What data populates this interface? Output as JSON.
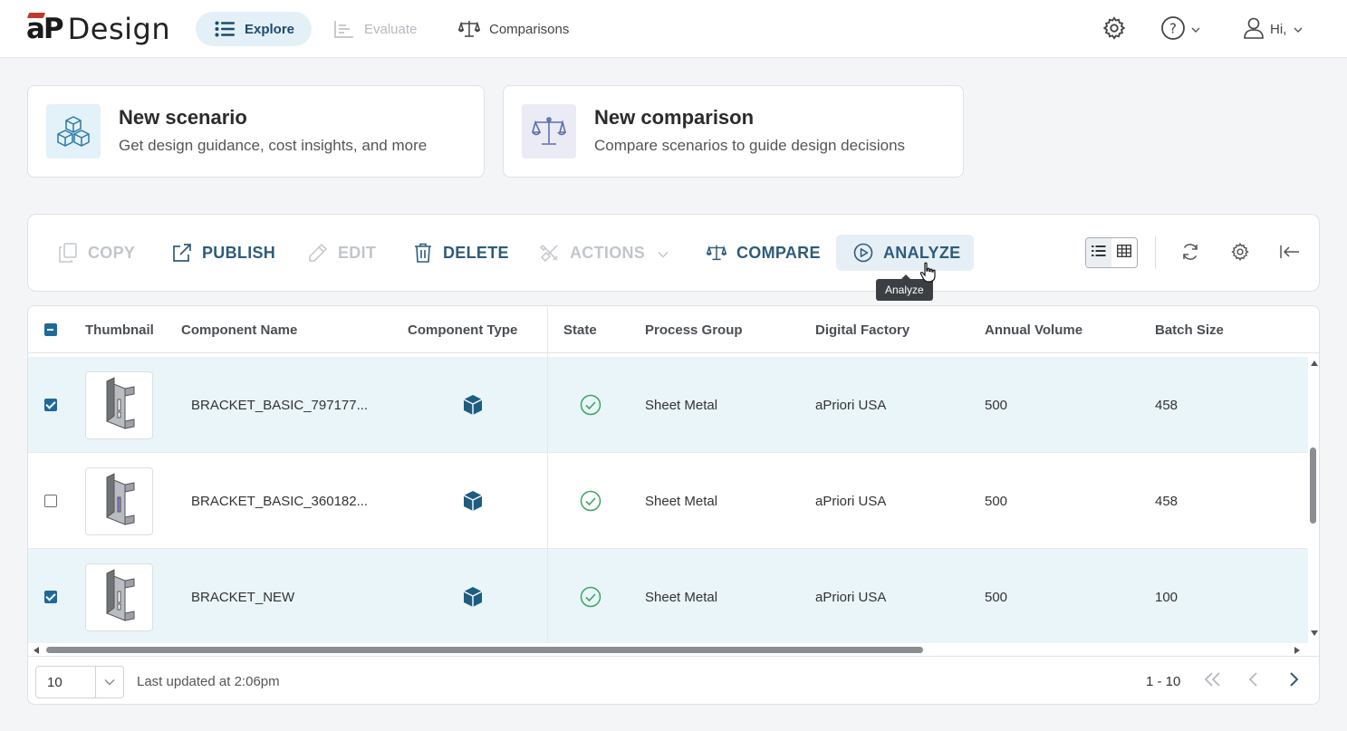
{
  "header": {
    "logo_mark": "aP",
    "logo_text": "Design",
    "nav": [
      {
        "label": "Explore",
        "icon": "list-icon",
        "state": "active"
      },
      {
        "label": "Evaluate",
        "icon": "chart-icon",
        "state": "disabled"
      },
      {
        "label": "Comparisons",
        "icon": "scale-icon",
        "state": "normal"
      }
    ],
    "user_greeting": "Hi,"
  },
  "cards": {
    "scenario": {
      "title": "New scenario",
      "subtitle": "Get design guidance, cost insights, and more"
    },
    "comparison": {
      "title": "New comparison",
      "subtitle": "Compare scenarios to guide design decisions"
    }
  },
  "toolbar": {
    "copy": "COPY",
    "publish": "PUBLISH",
    "edit": "EDIT",
    "delete": "DELETE",
    "actions": "ACTIONS",
    "compare": "COMPARE",
    "analyze": "ANALYZE",
    "tooltip": "Analyze"
  },
  "table": {
    "columns": [
      "Thumbnail",
      "Component Name",
      "Component Type",
      "State",
      "Process Group",
      "Digital Factory",
      "Annual Volume",
      "Batch Size"
    ],
    "rows": [
      {
        "checked": true,
        "name": "BRACKET_BASIC_797177...",
        "process_group": "Sheet Metal",
        "digital_factory": "aPriori USA",
        "annual_volume": "500",
        "batch_size": "458"
      },
      {
        "checked": false,
        "name": "BRACKET_BASIC_360182...",
        "process_group": "Sheet Metal",
        "digital_factory": "aPriori USA",
        "annual_volume": "500",
        "batch_size": "458"
      },
      {
        "checked": true,
        "name": "BRACKET_NEW",
        "process_group": "Sheet Metal",
        "digital_factory": "aPriori USA",
        "annual_volume": "500",
        "batch_size": "100"
      }
    ]
  },
  "footer": {
    "page_size": "10",
    "last_updated": "Last updated at 2:06pm",
    "page_range": "1 - 10"
  },
  "colors": {
    "accent": "#1e6a9c",
    "toolbar_text": "#2e5c7a",
    "selected_row": "#e9f5f9",
    "state_ok": "#3aa55c",
    "component_icon": "#1f5d80"
  }
}
